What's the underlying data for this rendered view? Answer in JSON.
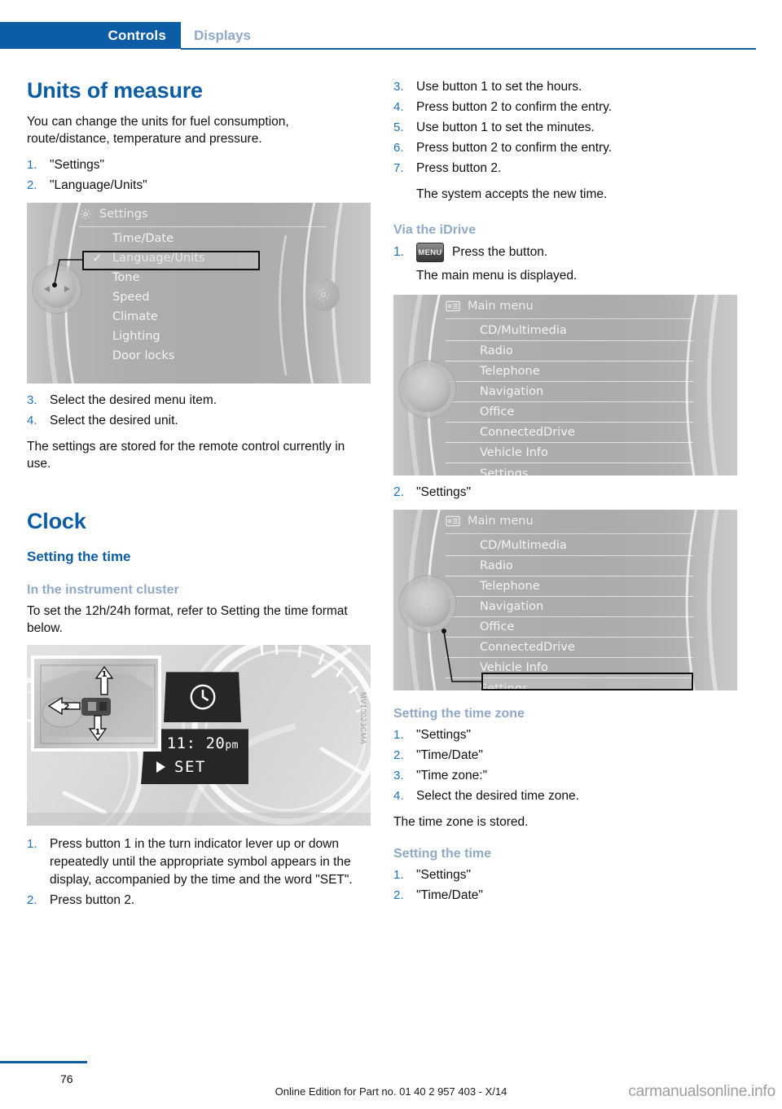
{
  "header": {
    "active_tab": "Controls",
    "inactive_tab": "Displays",
    "accent_color": "#0d5ca6"
  },
  "left_column": {
    "heading": "Units of measure",
    "intro": "You can change the units for fuel consumption, route/distance, temperature and pressure.",
    "steps_top": [
      {
        "num": "1.",
        "text": "\"Settings\""
      },
      {
        "num": "2.",
        "text": "\"Language/Units\""
      }
    ],
    "settings_figure": {
      "title": "Settings",
      "title_icon": "gear-icon",
      "items": [
        {
          "label": "Time/Date",
          "checked": false,
          "selected": false
        },
        {
          "label": "Language/Units",
          "checked": true,
          "selected": true
        },
        {
          "label": "Tone",
          "checked": false,
          "selected": false
        },
        {
          "label": "Speed",
          "checked": false,
          "selected": false
        },
        {
          "label": "Climate",
          "checked": false,
          "selected": false
        },
        {
          "label": "Lighting",
          "checked": false,
          "selected": false
        },
        {
          "label": "Door locks",
          "checked": false,
          "selected": false
        }
      ],
      "check_glyph": "✓"
    },
    "steps_mid": [
      {
        "num": "3.",
        "text": "Select the desired menu item."
      },
      {
        "num": "4.",
        "text": "Select the desired unit."
      }
    ],
    "stored_note": "The settings are stored for the remote control currently in use.",
    "clock_heading": "Clock",
    "setting_time_heading": "Setting the time",
    "instrument_cluster_heading": "In the instrument cluster",
    "format_note": "To set the 12h/24h format, refer to Setting the time format below.",
    "cluster_figure": {
      "time": "11: 20",
      "ampm": "pm",
      "set_label": "SET",
      "clock_icon": "clock-icon",
      "arrow_icon": "play-triangle-icon",
      "callout_1": "1",
      "callout_2": "2",
      "watermark": "MV10023CMA"
    },
    "steps_bottom": [
      {
        "num": "1.",
        "text": "Press button 1 in the turn indicator lever up or down repeatedly until the appropriate symbol appears in the display, accompanied by the time and the word \"SET\"."
      },
      {
        "num": "2.",
        "text": "Press button 2."
      }
    ]
  },
  "right_column": {
    "steps_top": [
      {
        "num": "3.",
        "text": "Use button 1 to set the hours."
      },
      {
        "num": "4.",
        "text": "Press button 2 to confirm the entry."
      },
      {
        "num": "5.",
        "text": "Use button 1 to set the minutes."
      },
      {
        "num": "6.",
        "text": "Press button 2 to confirm the entry."
      },
      {
        "num": "7.",
        "text": "Press button 2."
      }
    ],
    "accepts_note": "The system accepts the new time.",
    "via_idrive_heading": "Via the iDrive",
    "idrive_step_1_num": "1.",
    "idrive_step_1_text": "Press the button.",
    "menu_button_label": "MENU",
    "main_menu_displayed": "The main menu is displayed.",
    "main_menu_figure_1": {
      "title": "Main menu",
      "title_icon": "list-icon",
      "items": [
        "CD/Multimedia",
        "Radio",
        "Telephone",
        "Navigation",
        "Office",
        "ConnectedDrive",
        "Vehicle Info",
        "Settings"
      ],
      "selected": null,
      "knob_icon": "controller-knob-icon"
    },
    "idrive_step_2_num": "2.",
    "idrive_step_2_text": "\"Settings\"",
    "main_menu_figure_2": {
      "title": "Main menu",
      "title_icon": "list-icon",
      "items": [
        "CD/Multimedia",
        "Radio",
        "Telephone",
        "Navigation",
        "Office",
        "ConnectedDrive",
        "Vehicle Info",
        "Settings"
      ],
      "selected": "Settings",
      "knob_icon": "gear-icon"
    },
    "time_zone_heading": "Setting the time zone",
    "time_zone_steps": [
      {
        "num": "1.",
        "text": "\"Settings\""
      },
      {
        "num": "2.",
        "text": "\"Time/Date\""
      },
      {
        "num": "3.",
        "text": "\"Time zone:\""
      },
      {
        "num": "4.",
        "text": "Select the desired time zone."
      }
    ],
    "time_zone_stored": "The time zone is stored.",
    "setting_time_heading": "Setting the time",
    "setting_time_steps": [
      {
        "num": "1.",
        "text": "\"Settings\""
      },
      {
        "num": "2.",
        "text": "\"Time/Date\""
      }
    ]
  },
  "footer": {
    "page_number": "76",
    "edition_text": "Online Edition for Part no. 01 40 2 957 403 - X/14",
    "watermark": "carmanualsonline.info"
  }
}
